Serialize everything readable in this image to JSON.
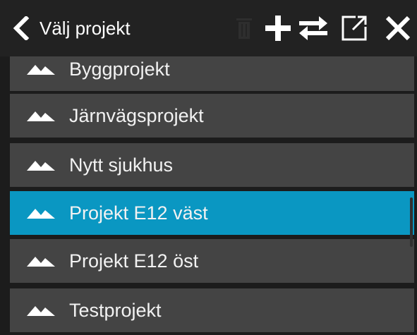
{
  "header": {
    "title": "Välj projekt",
    "icons": {
      "back": "chevron-left-icon",
      "trash": "trash-icon",
      "add": "plus-icon",
      "swap": "swap-arrows-icon",
      "open": "open-external-icon",
      "close": "close-icon"
    }
  },
  "colors": {
    "background": "#1c1c1c",
    "header": "#222222",
    "item": "#444444",
    "selected": "#0a97c2",
    "text": "#f2f2f2"
  },
  "projects": {
    "items": [
      {
        "label": "Byggprojekt",
        "icon": "mountain-icon",
        "selected": false
      },
      {
        "label": "Järnvägsprojekt",
        "icon": "mountain-icon",
        "selected": false
      },
      {
        "label": "Nytt sjukhus",
        "icon": "mountain-icon",
        "selected": false
      },
      {
        "label": "Projekt E12 väst",
        "icon": "mountain-icon",
        "selected": true
      },
      {
        "label": "Projekt E12 öst",
        "icon": "mountain-icon",
        "selected": false
      },
      {
        "label": "Testprojekt",
        "icon": "mountain-icon",
        "selected": false
      }
    ]
  }
}
